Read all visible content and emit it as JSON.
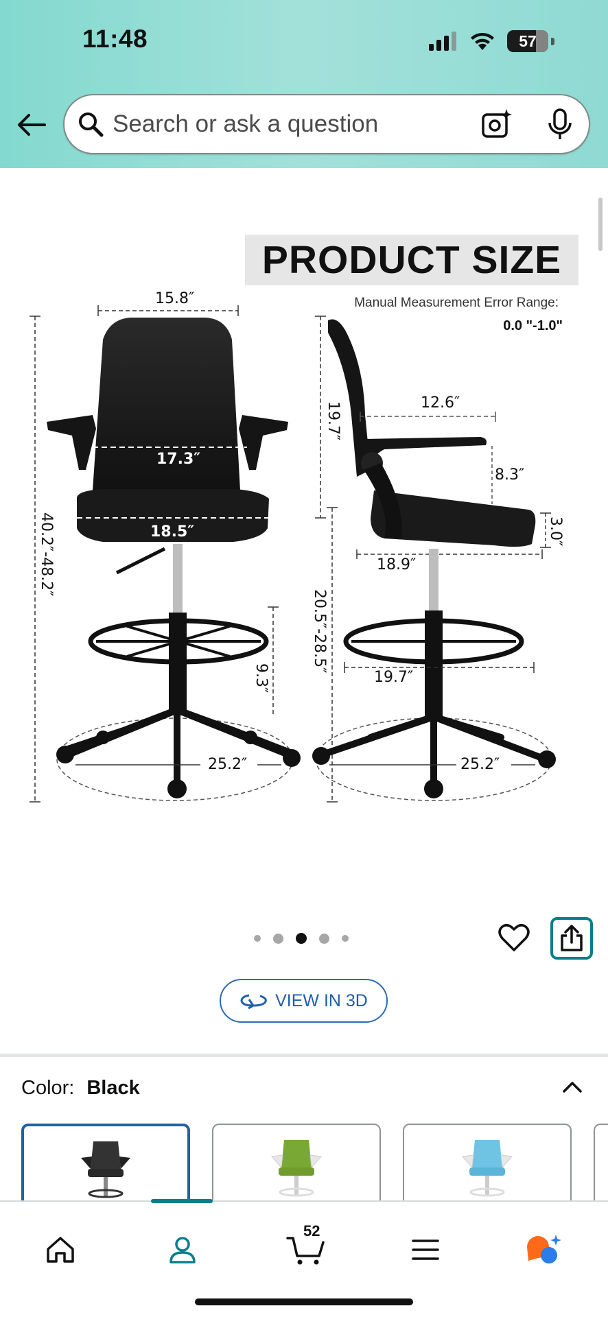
{
  "status_bar": {
    "time": "11:48",
    "battery": "57"
  },
  "search": {
    "placeholder": "Search or ask a question"
  },
  "product_image": {
    "heading": "PRODUCT SIZE",
    "error_range_label": "Manual Measurement Error Range:",
    "error_range_value": "0.0 \"-1.0\"",
    "dimensions": {
      "back_width": "15.8″",
      "seat_back_width": "17.3″",
      "seat_width": "18.5″",
      "total_height": "40.2″-48.2″",
      "footrest_height": "9.3″",
      "base_diameter_front": "25.2″",
      "back_height": "19.7″",
      "armrest_depth": "12.6″",
      "armrest_height": "8.3″",
      "seat_thickness": "3.0″",
      "seat_depth": "18.9″",
      "seat_height": "20.5″-28.5″",
      "footrest_diameter": "19.7″",
      "base_diameter_side": "25.2″"
    }
  },
  "carousel": {
    "total": 5,
    "active_index": 2
  },
  "view_3d": {
    "label": "VIEW IN 3D"
  },
  "color": {
    "label": "Color:",
    "value": "Black",
    "options": [
      "Black",
      "Green",
      "Blue"
    ]
  },
  "bottom_nav": {
    "cart_count": "52"
  },
  "colors": {
    "accent": "#0a7e8c",
    "link": "#2162a1",
    "header": "#9be0d8"
  }
}
